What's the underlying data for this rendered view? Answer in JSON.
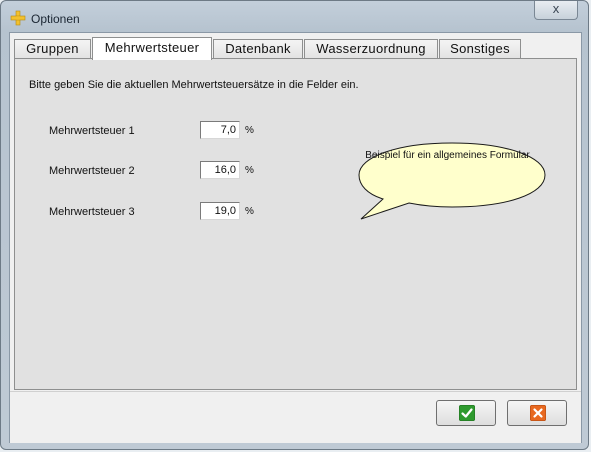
{
  "window": {
    "title": "Optionen",
    "close_label": "x"
  },
  "tabs": [
    {
      "label": "Gruppen"
    },
    {
      "label": "Mehrwertsteuer"
    },
    {
      "label": "Datenbank"
    },
    {
      "label": "Wasserzuordnung"
    },
    {
      "label": "Sonstiges"
    }
  ],
  "active_tab": "Mehrwertsteuer",
  "panel": {
    "instruction": "Bitte geben Sie die aktuellen Mehrwertsteuersätze in die Felder ein.",
    "rows": [
      {
        "label": "Mehrwertsteuer 1",
        "value": "7,0",
        "unit": "%"
      },
      {
        "label": "Mehrwertsteuer 2",
        "value": "16,0",
        "unit": "%"
      },
      {
        "label": "Mehrwertsteuer 3",
        "value": "19,0",
        "unit": "%"
      }
    ],
    "callout": {
      "text": "Beispiel für ein allgemeines Formular"
    }
  },
  "buttons": {
    "ok_icon": "check-icon",
    "cancel_icon": "cancel-x-icon"
  },
  "colors": {
    "ok_green": "#2e9a2e",
    "cancel_orange": "#e8681f",
    "callout_fill": "#ffffcc",
    "app_icon_yellow": "#f2c12e"
  }
}
